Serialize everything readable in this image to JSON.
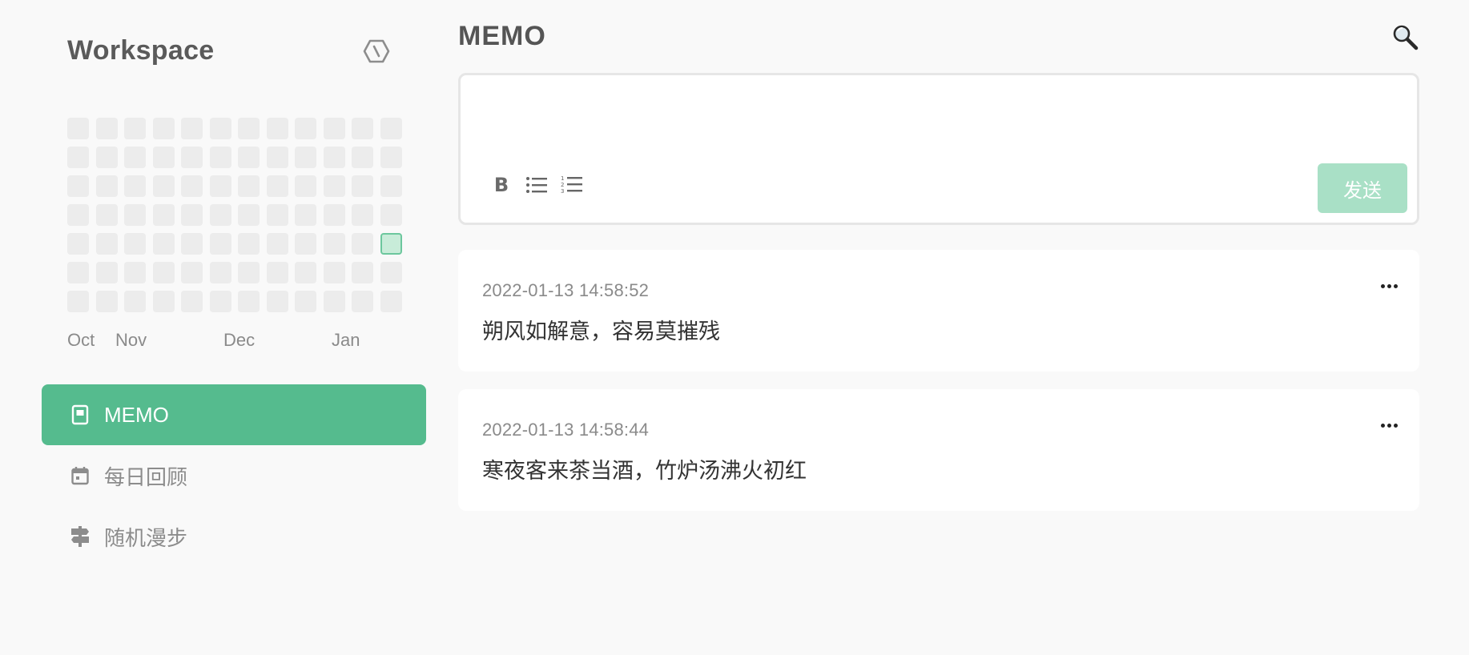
{
  "sidebar": {
    "title": "Workspace",
    "settings_icon": "hexagon-settings-icon",
    "heatmap": {
      "rows": 7,
      "cols": 12,
      "active_cells": [
        {
          "row": 4,
          "col": 11,
          "level": 1
        }
      ],
      "months": [
        "Oct",
        "Nov",
        "Dec",
        "Jan"
      ]
    },
    "nav": [
      {
        "label": "MEMO",
        "icon": "memo-icon",
        "active": true
      },
      {
        "label": "每日回顾",
        "icon": "calendar-icon",
        "active": false
      },
      {
        "label": "随机漫步",
        "icon": "signpost-icon",
        "active": false
      }
    ]
  },
  "main": {
    "title": "MEMO",
    "search_icon": "search-icon",
    "editor": {
      "value": "",
      "toolbar": {
        "bold_label": "B",
        "bullet_icon": "bullet-list-icon",
        "ordered_icon": "ordered-list-icon"
      },
      "send_label": "发送"
    },
    "memos": [
      {
        "time": "2022-01-13 14:58:52",
        "text": "朔风如解意，容易莫摧残"
      },
      {
        "time": "2022-01-13 14:58:44",
        "text": "寒夜客来茶当酒，竹炉汤沸火初红"
      }
    ]
  },
  "colors": {
    "accent": "#55bb8e",
    "send_disabled": "#a9e0c6",
    "heat_empty": "#ececec",
    "heat_level1": "#c8ecd9"
  }
}
